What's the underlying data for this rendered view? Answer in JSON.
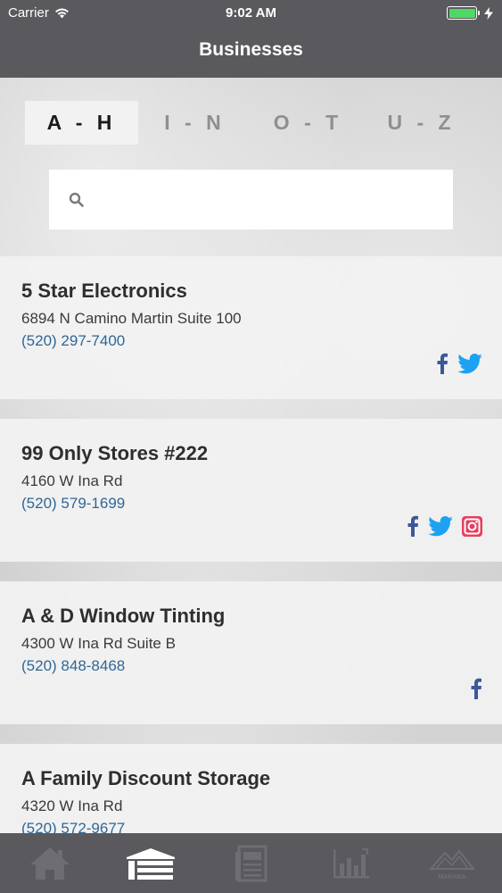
{
  "status_bar": {
    "carrier": "Carrier",
    "time": "9:02 AM",
    "battery_color": "#4cd964"
  },
  "nav": {
    "title": "Businesses"
  },
  "segments": [
    {
      "label": "A - H",
      "active": true
    },
    {
      "label": "I - N",
      "active": false
    },
    {
      "label": "O - T",
      "active": false
    },
    {
      "label": "U - Z",
      "active": false
    }
  ],
  "search": {
    "value": "",
    "placeholder": ""
  },
  "businesses": [
    {
      "name": "5 Star Electronics",
      "address": "6894 N Camino Martin Suite 100",
      "phone": "(520) 297-7400",
      "socials": [
        "facebook-icon",
        "twitter-icon"
      ]
    },
    {
      "name": "99 Only Stores #222",
      "address": "4160 W Ina Rd",
      "phone": "(520) 579-1699",
      "socials": [
        "facebook-icon",
        "twitter-icon",
        "instagram-icon"
      ]
    },
    {
      "name": "A & D Window Tinting",
      "address": "4300 W Ina Rd Suite B",
      "phone": "(520) 848-8468",
      "socials": [
        "facebook-icon"
      ]
    },
    {
      "name": "A Family Discount Storage",
      "address": "4320 W Ina Rd",
      "phone": "(520) 572-9677",
      "socials": []
    }
  ],
  "tabs": [
    {
      "icon": "home-icon",
      "active": false
    },
    {
      "icon": "businesses-icon",
      "active": true
    },
    {
      "icon": "news-icon",
      "active": false
    },
    {
      "icon": "stats-icon",
      "active": false
    },
    {
      "icon": "marana-logo-icon",
      "active": false,
      "logo_text": "MARANA"
    }
  ],
  "colors": {
    "bar": "#5a5a5e",
    "phone": "#2f6796",
    "facebook": "#3b5998",
    "twitter": "#1da1f2",
    "instagram": "#e4405f"
  }
}
